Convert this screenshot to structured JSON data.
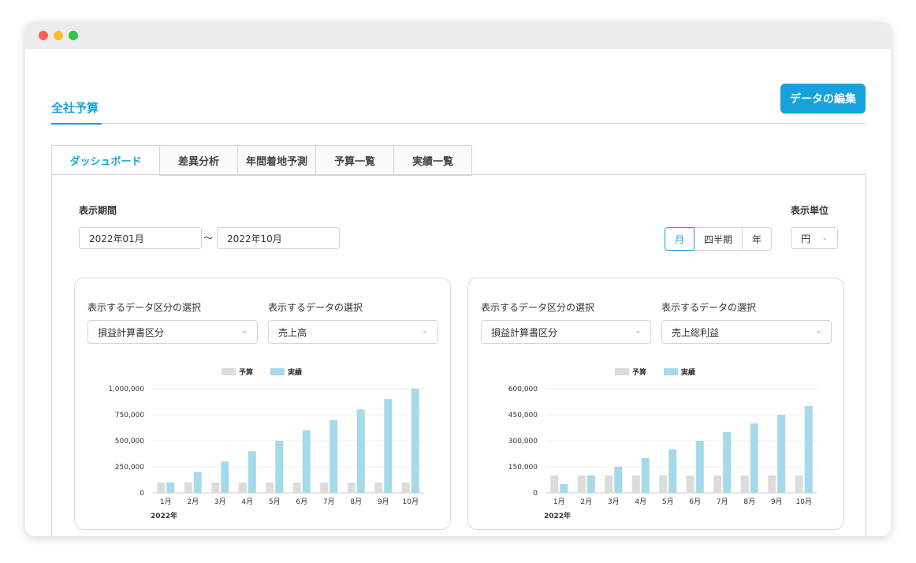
{
  "window": {
    "dots": [
      "#ff5f57",
      "#febc2e",
      "#28c840"
    ]
  },
  "header": {
    "title": "全社予算",
    "edit_button": "データの編集"
  },
  "tabs": [
    "ダッシュボード",
    "差異分析",
    "年間着地予測",
    "予算一覧",
    "実績一覧"
  ],
  "filters": {
    "period_label": "表示期間",
    "start": "2022年01月",
    "tilde": "〜",
    "end": "2022年10月",
    "unit_label": "表示単位",
    "unit_options": [
      "月",
      "四半期",
      "年"
    ],
    "unit_selected": "月",
    "currency": "円"
  },
  "cards": [
    {
      "category_label": "表示するデータ区分の選択",
      "category_value": "損益計算書区分",
      "data_label": "表示するデータの選択",
      "data_value": "売上高"
    },
    {
      "category_label": "表示するデータ区分の選択",
      "category_value": "損益計算書区分",
      "data_label": "表示するデータの選択",
      "data_value": "売上総利益"
    }
  ],
  "chart_data": [
    {
      "type": "bar",
      "categories": [
        "1月",
        "2月",
        "3月",
        "4月",
        "5月",
        "6月",
        "7月",
        "8月",
        "9月",
        "10月"
      ],
      "x_sublabel": "2022年",
      "series": [
        {
          "name": "予算",
          "color": "#dcdcdc",
          "values": [
            100000,
            100000,
            100000,
            100000,
            100000,
            100000,
            100000,
            100000,
            100000,
            100000
          ]
        },
        {
          "name": "実績",
          "color": "#a6d9ea",
          "values": [
            100000,
            200000,
            300000,
            400000,
            500000,
            600000,
            700000,
            800000,
            900000,
            1000000
          ]
        }
      ],
      "ylim": [
        0,
        1000000
      ],
      "yticks": [
        "0",
        "250,000",
        "500,000",
        "750,000",
        "1,000,000"
      ],
      "legend": "top-center",
      "grid": true
    },
    {
      "type": "bar",
      "categories": [
        "1月",
        "2月",
        "3月",
        "4月",
        "5月",
        "6月",
        "7月",
        "8月",
        "9月",
        "10月"
      ],
      "x_sublabel": "2022年",
      "series": [
        {
          "name": "予算",
          "color": "#dcdcdc",
          "values": [
            100000,
            100000,
            100000,
            100000,
            100000,
            100000,
            100000,
            100000,
            100000,
            100000
          ]
        },
        {
          "name": "実績",
          "color": "#a6d9ea",
          "values": [
            50000,
            100000,
            150000,
            200000,
            250000,
            300000,
            350000,
            400000,
            450000,
            500000
          ]
        }
      ],
      "ylim": [
        0,
        600000
      ],
      "yticks": [
        "0",
        "150,000",
        "300,000",
        "450,000",
        "600,000"
      ],
      "legend": "top-center",
      "grid": true
    }
  ]
}
